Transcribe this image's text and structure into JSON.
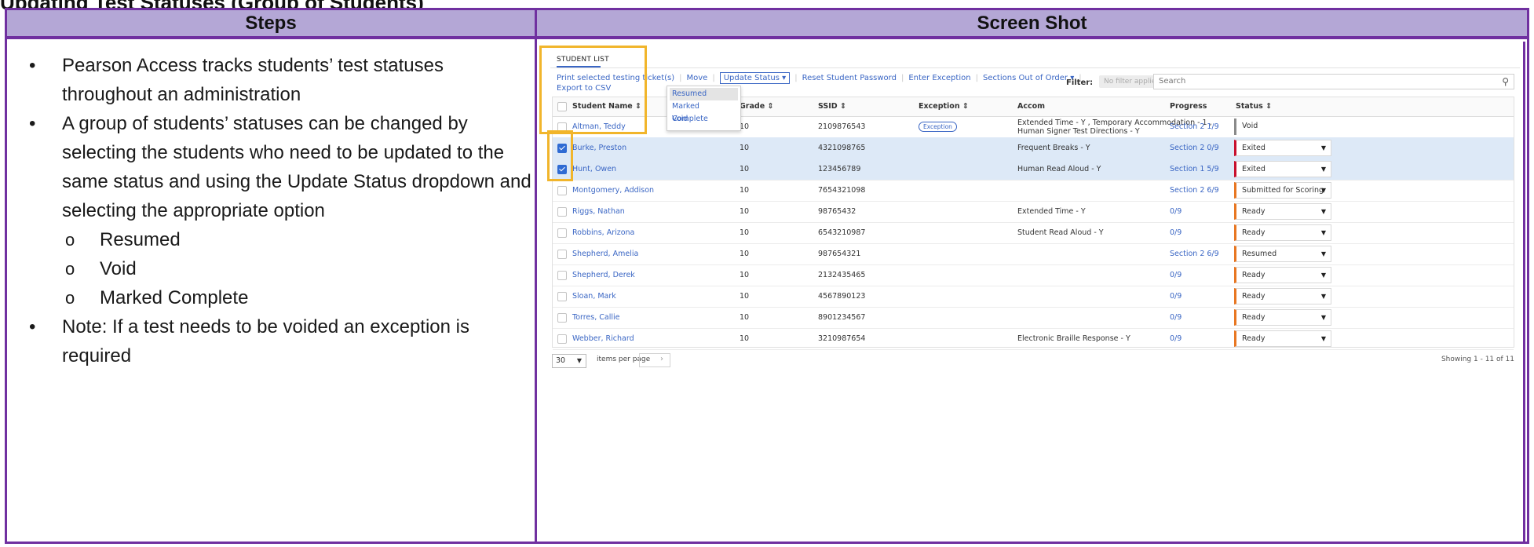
{
  "document": {
    "clipped_heading": "Updating Test Statuses (Group of Students)",
    "headers": {
      "steps": "Steps",
      "screenshot": "Screen Shot"
    },
    "steps": [
      {
        "text": "Pearson Access tracks students’ test statuses throughout an administration"
      },
      {
        "text": "A group of students’ statuses can be changed by selecting the students who need to be updated to the same status and using the Update Status dropdown and selecting the appropriate option"
      },
      {
        "text": "Note: If a test needs to be voided an exception is required"
      }
    ],
    "sub_steps": [
      "Resumed",
      "Void",
      "Marked Complete"
    ],
    "highlight_color": "#f1b52b",
    "border_color": "#7030a0",
    "header_bg": "#b4a7d6"
  },
  "screenshot": {
    "section_title": "STUDENT LIST",
    "actions": [
      "Print selected testing ticket(s)",
      "Move",
      "Update Status",
      "Reset Student Password",
      "Enter Exception",
      "Sections Out of Order"
    ],
    "export": "Export to CSV",
    "filter": {
      "label": "Filter:",
      "value": "No filter applied",
      "search_placeholder": "Search"
    },
    "dropdown_menu": [
      "Resumed",
      "Marked Complete",
      "Void"
    ],
    "columns": [
      "Student Name",
      "Grade",
      "SSID",
      "Exception",
      "Accom",
      "Progress",
      "Status"
    ],
    "rows": [
      {
        "name": "Altman, Teddy",
        "grade": "10",
        "ssid": "2109876543",
        "exception": "Exception",
        "accom": "Extended Time - Y , Temporary Accommodation - 1 ,",
        "accom2": "Human Signer Test Directions - Y",
        "progress": "Section 2 1/9",
        "status": "Void",
        "checked": false,
        "selected": false
      },
      {
        "name": "Burke, Preston",
        "grade": "10",
        "ssid": "4321098765",
        "exception": "",
        "accom": "Frequent Breaks - Y",
        "accom2": "",
        "progress": "Section 2 0/9",
        "status": "Exited",
        "checked": true,
        "selected": true
      },
      {
        "name": "Hunt, Owen",
        "grade": "10",
        "ssid": "123456789",
        "exception": "",
        "accom": "Human Read Aloud - Y",
        "accom2": "",
        "progress": "Section 1 5/9",
        "status": "Exited",
        "checked": true,
        "selected": true
      },
      {
        "name": "Montgomery, Addison",
        "grade": "10",
        "ssid": "7654321098",
        "exception": "",
        "accom": "",
        "accom2": "",
        "progress": "Section 2 6/9",
        "status": "Submitted for Scoring",
        "checked": false,
        "selected": false
      },
      {
        "name": "Riggs, Nathan",
        "grade": "10",
        "ssid": "98765432",
        "exception": "",
        "accom": "Extended Time - Y",
        "accom2": "",
        "progress": "0/9",
        "status": "Ready",
        "checked": false,
        "selected": false
      },
      {
        "name": "Robbins, Arizona",
        "grade": "10",
        "ssid": "6543210987",
        "exception": "",
        "accom": "Student Read Aloud - Y",
        "accom2": "",
        "progress": "0/9",
        "status": "Ready",
        "checked": false,
        "selected": false
      },
      {
        "name": "Shepherd, Amelia",
        "grade": "10",
        "ssid": "987654321",
        "exception": "",
        "accom": "",
        "accom2": "",
        "progress": "Section 2 6/9",
        "status": "Resumed",
        "checked": false,
        "selected": false
      },
      {
        "name": "Shepherd, Derek",
        "grade": "10",
        "ssid": "2132435465",
        "exception": "",
        "accom": "",
        "accom2": "",
        "progress": "0/9",
        "status": "Ready",
        "checked": false,
        "selected": false
      },
      {
        "name": "Sloan, Mark",
        "grade": "10",
        "ssid": "4567890123",
        "exception": "",
        "accom": "",
        "accom2": "",
        "progress": "0/9",
        "status": "Ready",
        "checked": false,
        "selected": false
      },
      {
        "name": "Torres, Callie",
        "grade": "10",
        "ssid": "8901234567",
        "exception": "",
        "accom": "",
        "accom2": "",
        "progress": "0/9",
        "status": "Ready",
        "checked": false,
        "selected": false
      },
      {
        "name": "Webber, Richard",
        "grade": "10",
        "ssid": "3210987654",
        "exception": "",
        "accom": "Electronic Braille Response - Y",
        "accom2": "",
        "progress": "0/9",
        "status": "Ready",
        "checked": false,
        "selected": false
      }
    ],
    "footer": {
      "page_size": "30",
      "items_per_page": "items per page",
      "showing": "Showing 1 - 11 of 11"
    }
  }
}
